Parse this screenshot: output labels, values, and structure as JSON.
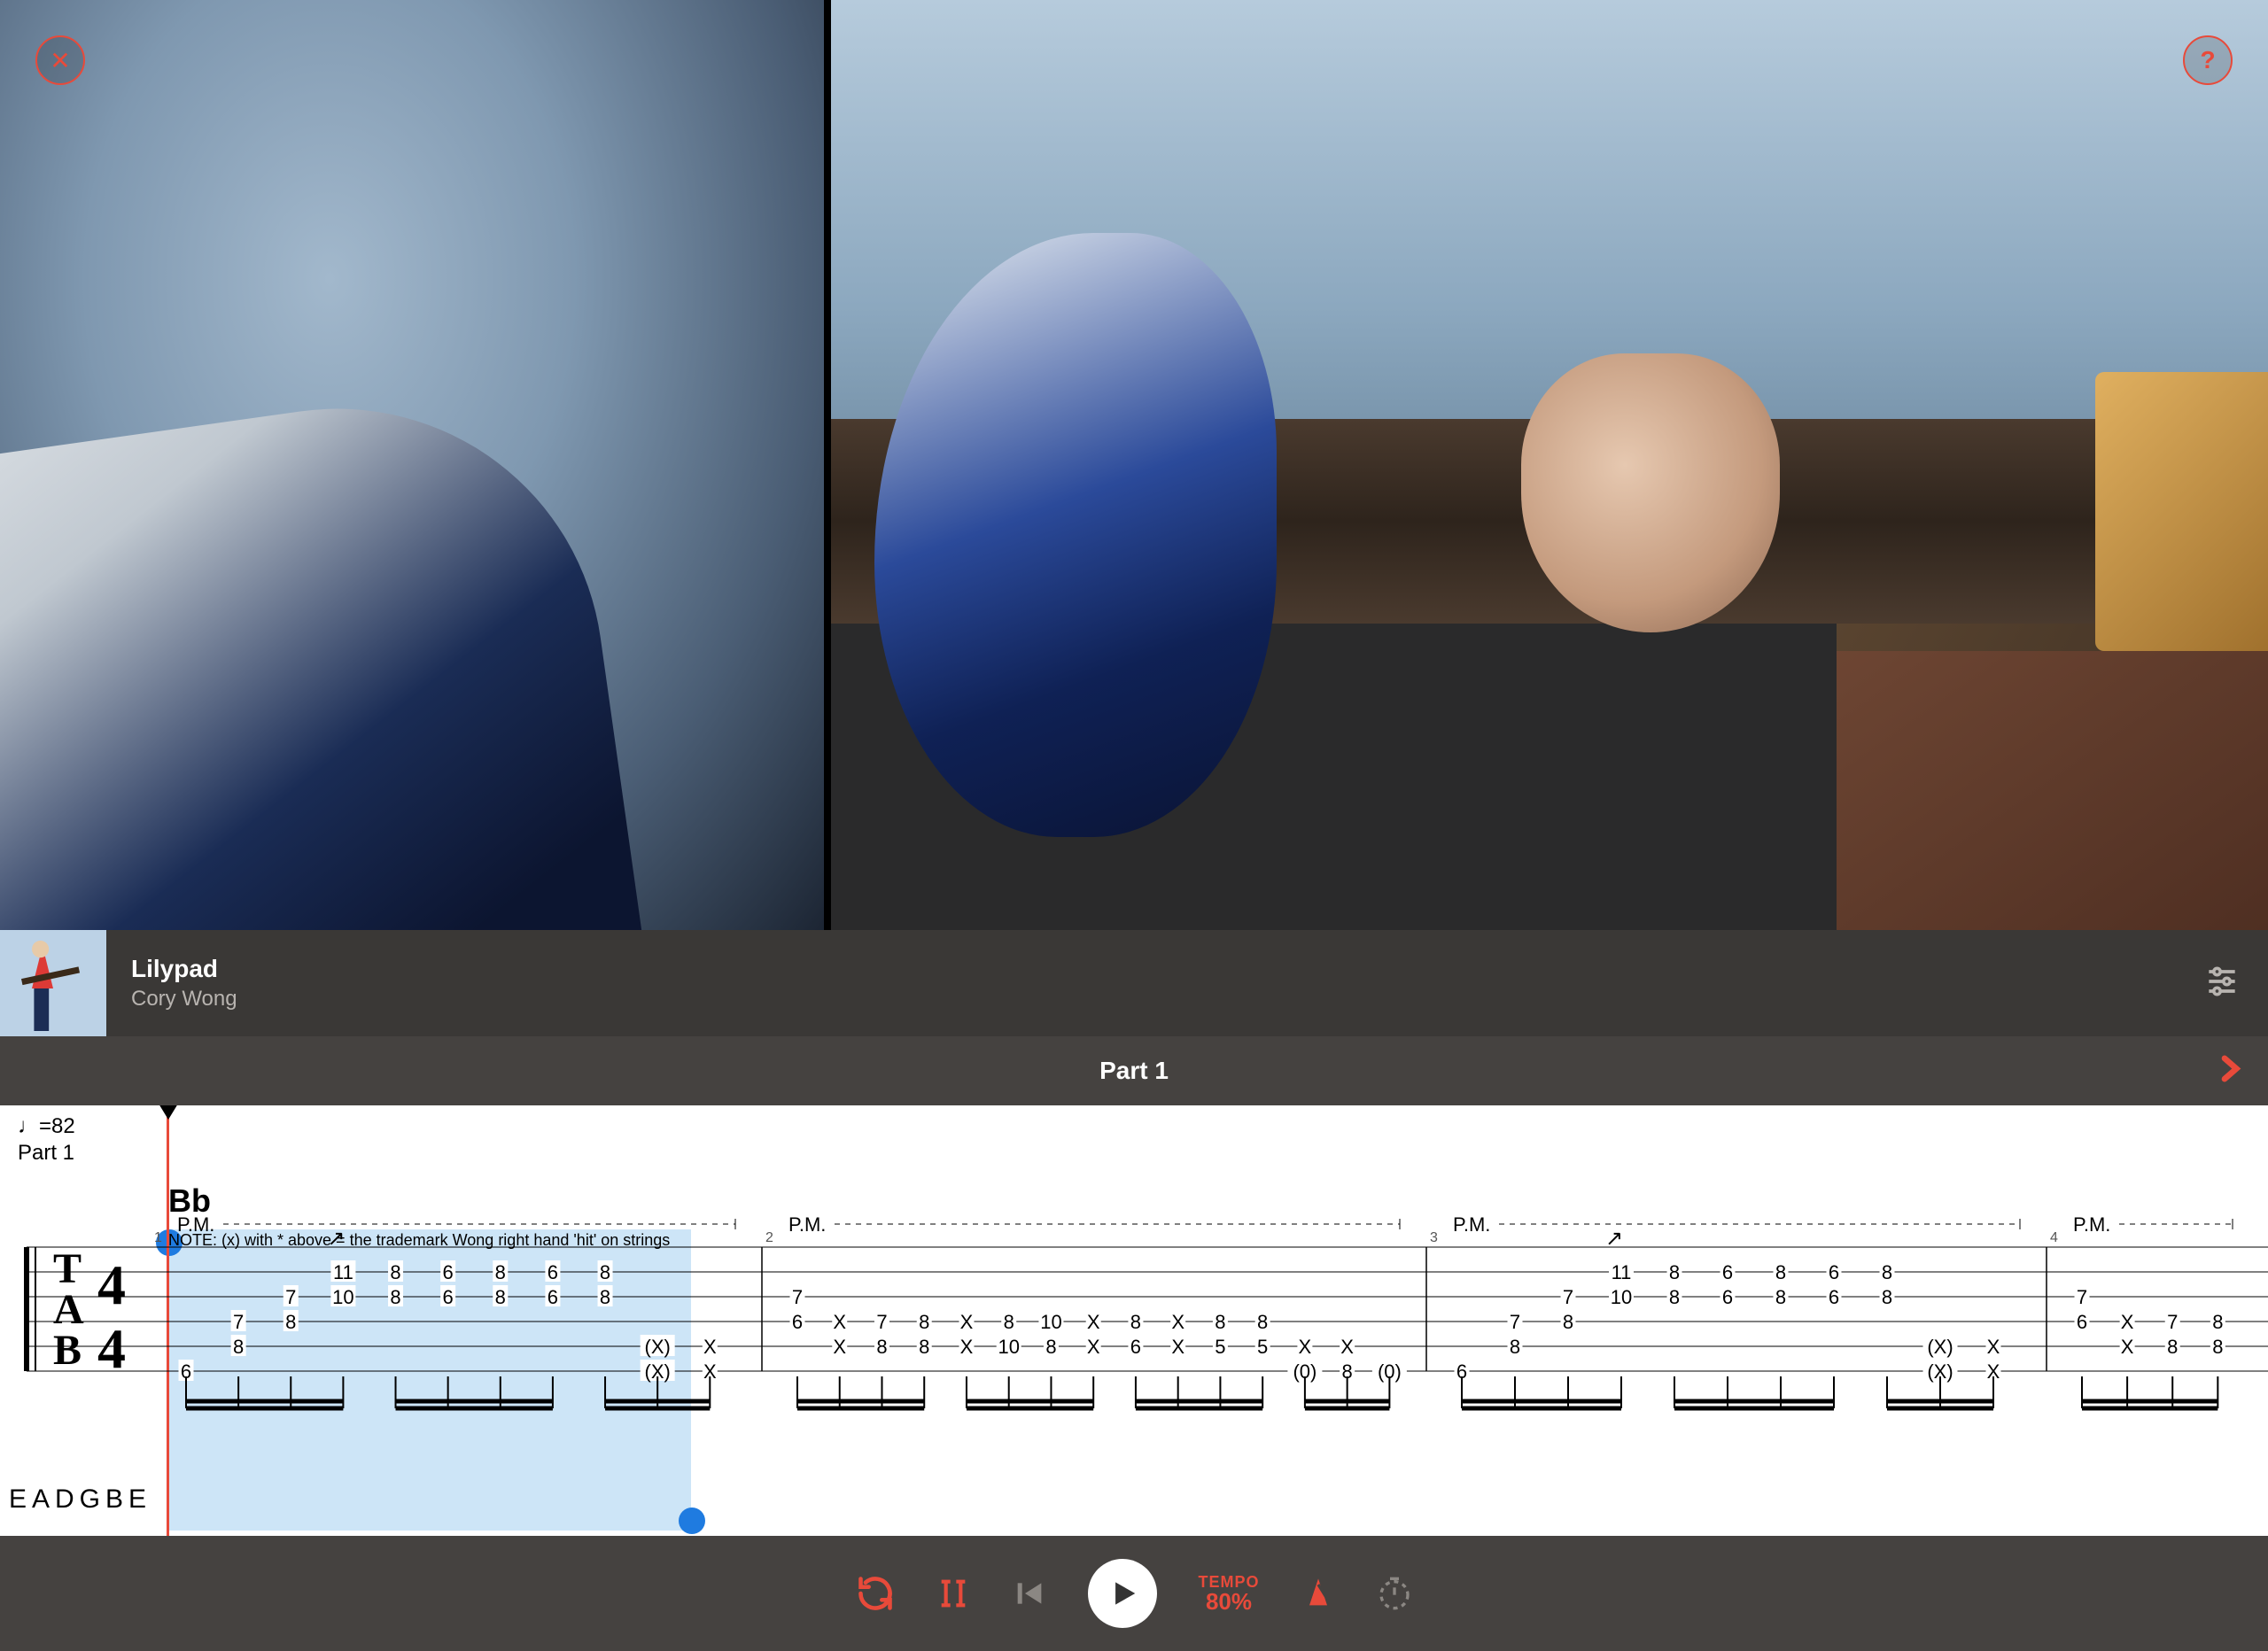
{
  "header": {
    "close_label": "✕",
    "help_label": "?"
  },
  "song": {
    "title": "Lilypad",
    "artist": "Cory Wong"
  },
  "part": {
    "title": "Part 1"
  },
  "tab": {
    "tempo_marking": "♩=82",
    "section_label": "Part 1",
    "chord": "Bb",
    "pm_label": "P.M.",
    "note_text": "NOTE: (x) with * above = the trademark Wong right hand 'hit' on strings",
    "tuning": "EADGBE",
    "time_sig_top": "4",
    "time_sig_bot": "4",
    "tab_letters": [
      "T",
      "A",
      "B"
    ],
    "measures": [
      {
        "num": "1",
        "columns": [
          {
            "s6": "6"
          },
          {
            "s5": "8",
            "s4": "7"
          },
          {
            "s4": "8",
            "s3": "7"
          },
          {
            "slide": true,
            "s3": "10",
            "s2": "11"
          },
          {
            "s3": "8",
            "s2": "8"
          },
          {
            "s3": "6",
            "s2": "6"
          },
          {
            "s3": "8",
            "s2": "8"
          },
          {
            "s3": "6",
            "s2": "6"
          },
          {
            "s3": "8",
            "s2": "8"
          },
          {
            "s5": "(X)",
            "s6": "(X)"
          },
          {
            "s5": "X",
            "s6": "X"
          }
        ]
      },
      {
        "num": "2",
        "columns": [
          {
            "s4": "6",
            "s3": "7"
          },
          {
            "s4": "X",
            "s5": "X"
          },
          {
            "s4": "7",
            "s5": "8"
          },
          {
            "s4": "8",
            "s5": "8"
          },
          {
            "s4": "X",
            "s5": "X"
          },
          {
            "s4": "8",
            "s5": "10"
          },
          {
            "s4": "10",
            "s5": "8"
          },
          {
            "s4": "X",
            "s5": "X"
          },
          {
            "s4": "8",
            "s5": "6"
          },
          {
            "s4": "X",
            "s5": "X"
          },
          {
            "s4": "8",
            "s5": "5"
          },
          {
            "s4": "8",
            "s5": "5"
          },
          {
            "s5": "X",
            "s6": "(0)"
          },
          {
            "s5": "X",
            "s6": "8"
          },
          {
            "s6": "(0)"
          }
        ]
      },
      {
        "num": "3",
        "columns": [
          {
            "s6": "6"
          },
          {
            "s5": "8",
            "s4": "7"
          },
          {
            "s4": "8",
            "s3": "7"
          },
          {
            "slide": true,
            "s3": "10",
            "s2": "11"
          },
          {
            "s3": "8",
            "s2": "8"
          },
          {
            "s3": "6",
            "s2": "6"
          },
          {
            "s3": "8",
            "s2": "8"
          },
          {
            "s3": "6",
            "s2": "6"
          },
          {
            "s3": "8",
            "s2": "8"
          },
          {
            "s5": "(X)",
            "s6": "(X)"
          },
          {
            "s5": "X",
            "s6": "X"
          }
        ]
      },
      {
        "num": "4",
        "columns": [
          {
            "s4": "6",
            "s3": "7"
          },
          {
            "s4": "X",
            "s5": "X"
          },
          {
            "s4": "7",
            "s5": "8"
          },
          {
            "s4": "8",
            "s5": "8"
          }
        ]
      }
    ]
  },
  "controls": {
    "tempo_label": "TEMPO",
    "tempo_value": "80%"
  },
  "colors": {
    "accent": "#e84a3a",
    "loop_blue": "#1f7be0"
  }
}
